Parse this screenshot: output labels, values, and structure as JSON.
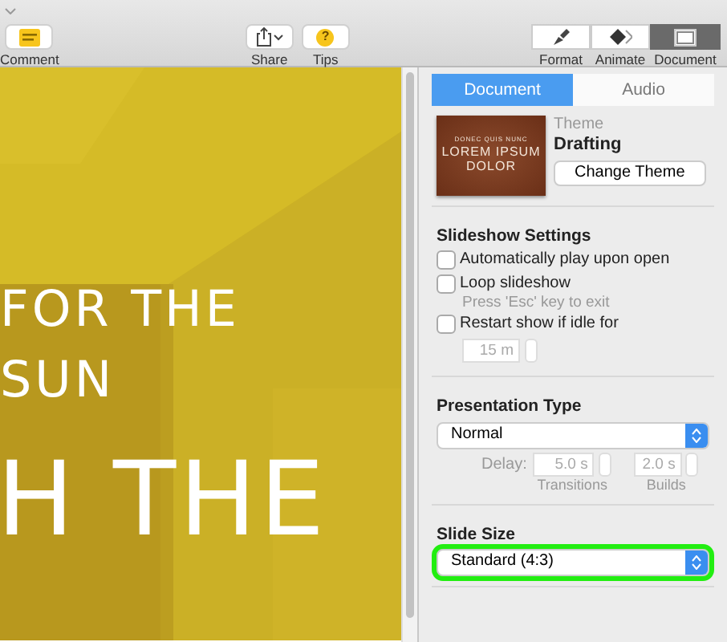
{
  "toolbar": {
    "left": [
      {
        "label": "Comment",
        "kind": "comment"
      }
    ],
    "center": [
      {
        "label": "Share",
        "kind": "share"
      },
      {
        "label": "Tips",
        "kind": "tips",
        "glyph": "?"
      }
    ],
    "segments": [
      {
        "label": "Format",
        "kind": "brush",
        "selected": false
      },
      {
        "label": "Animate",
        "kind": "diamond",
        "selected": false
      },
      {
        "label": "Document",
        "kind": "document",
        "selected": true
      }
    ]
  },
  "slide": {
    "lines": [
      "FOR THE",
      "SUN",
      "H THE"
    ]
  },
  "inspector": {
    "tabs": [
      {
        "label": "Document",
        "selected": true
      },
      {
        "label": "Audio",
        "selected": false
      }
    ],
    "theme": {
      "thumbnail_lines": [
        "DONEC QUIS NUNC",
        "LOREM IPSUM",
        "DOLOR"
      ],
      "label": "Theme",
      "name": "Drafting",
      "button": "Change Theme"
    },
    "slideshow": {
      "title": "Slideshow Settings",
      "options": [
        {
          "label": "Automatically play upon open",
          "checked": false
        },
        {
          "label": "Loop slideshow",
          "checked": false,
          "hint": "Press 'Esc' key to exit"
        },
        {
          "label": "Restart show if idle for",
          "checked": false,
          "stepper": {
            "value": "15 m",
            "disabled": true
          }
        }
      ]
    },
    "presentation": {
      "title": "Presentation Type",
      "value": "Normal",
      "delay_label": "Delay:",
      "delays": [
        {
          "value": "5.0 s",
          "caption": "Transitions",
          "disabled": true
        },
        {
          "value": "2.0 s",
          "caption": "Builds",
          "disabled": true
        }
      ]
    },
    "slide_size": {
      "title": "Slide Size",
      "value": "Standard (4:3)",
      "highlighted": true
    }
  }
}
